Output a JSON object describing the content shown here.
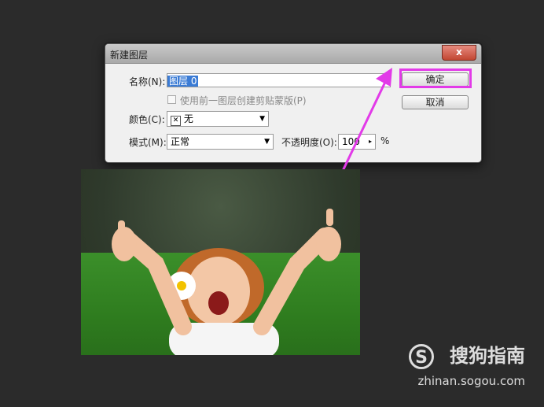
{
  "dialog": {
    "title": "新建图层",
    "close_label": "x",
    "name_label": "名称(N):",
    "name_value": "图层 0",
    "clip_label": "使用前一图层创建剪贴蒙版(P)",
    "color_label": "颜色(C):",
    "color_value": "无",
    "color_icon": "x-icon",
    "mode_label": "模式(M):",
    "mode_value": "正常",
    "opacity_label": "不透明度(O):",
    "opacity_value": "100",
    "opacity_unit": "%",
    "ok_label": "确定",
    "cancel_label": "取消"
  },
  "colors": {
    "highlight": "#e23ae8",
    "background": "#2b2b2b",
    "selection": "#3a7bd5"
  },
  "watermark": {
    "brand": "搜狗指南",
    "url": "zhinan.sogou.com",
    "logo_letter": "S"
  }
}
